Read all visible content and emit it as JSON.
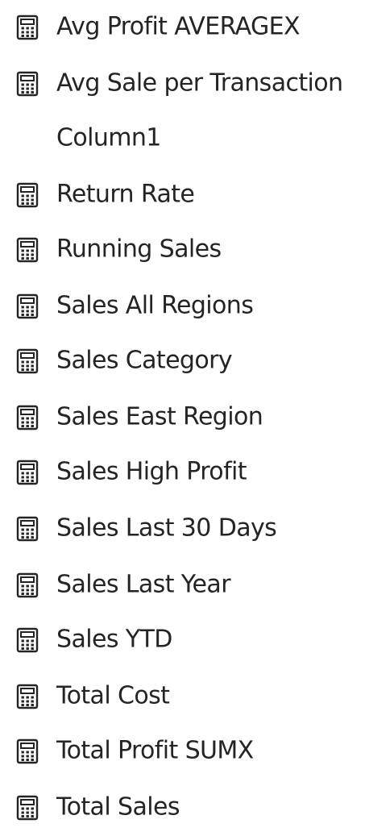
{
  "fields": [
    {
      "label": "Avg Profit AVERAGEX",
      "icon": "calculator-icon"
    },
    {
      "label": "Avg Sale per Transaction",
      "icon": "calculator-icon"
    },
    {
      "label": "Column1",
      "icon": ""
    },
    {
      "label": "Return Rate",
      "icon": "calculator-icon"
    },
    {
      "label": "Running Sales",
      "icon": "calculator-icon"
    },
    {
      "label": "Sales All Regions",
      "icon": "calculator-icon"
    },
    {
      "label": "Sales Category",
      "icon": "calculator-icon"
    },
    {
      "label": "Sales East Region",
      "icon": "calculator-icon"
    },
    {
      "label": "Sales High Profit",
      "icon": "calculator-icon"
    },
    {
      "label": "Sales Last 30 Days",
      "icon": "calculator-icon"
    },
    {
      "label": "Sales Last Year",
      "icon": "calculator-icon"
    },
    {
      "label": "Sales YTD",
      "icon": "calculator-icon"
    },
    {
      "label": "Total Cost",
      "icon": "calculator-icon"
    },
    {
      "label": "Total Profit SUMX",
      "icon": "calculator-icon"
    },
    {
      "label": "Total Sales",
      "icon": "calculator-icon"
    }
  ],
  "colors": {
    "text": "#252423",
    "icon": "#252423"
  }
}
